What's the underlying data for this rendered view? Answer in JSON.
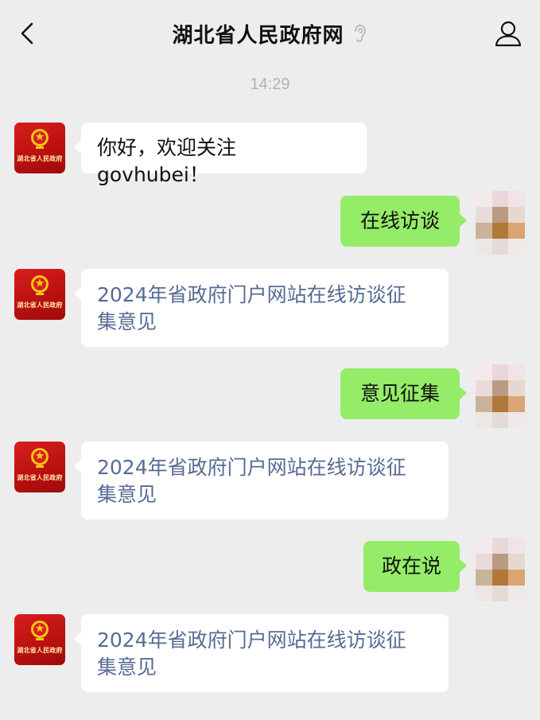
{
  "header": {
    "title": "湖北省人民政府网"
  },
  "timestamp": "14:29",
  "avatar_label": "湖北省人民政府",
  "messages": [
    {
      "from": "account",
      "text": "你好，欢迎关注 govhubei！"
    },
    {
      "from": "user",
      "text": "在线访谈"
    },
    {
      "from": "account",
      "line1": "2024年省政府门户网站在线访谈征",
      "line2": "集意见"
    },
    {
      "from": "user",
      "text": "意见征集"
    },
    {
      "from": "account",
      "line1": "2024年省政府门户网站在线访谈征",
      "line2": "集意见"
    },
    {
      "from": "user",
      "text": "政在说"
    },
    {
      "from": "account",
      "line1": "2024年省政府门户网站在线访谈征",
      "line2": "集意见"
    }
  ],
  "colors": {
    "background": "#ededed",
    "outgoing_bubble": "#95ec69",
    "incoming_bubble": "#ffffff",
    "link": "#576b95",
    "avatar_red": "#c81414"
  }
}
